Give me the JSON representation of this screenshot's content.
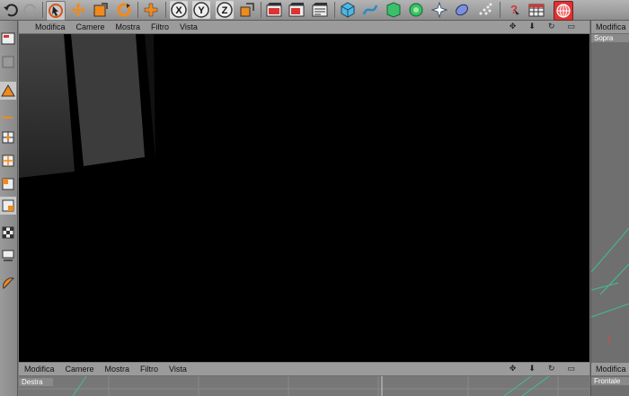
{
  "toolbar": {
    "icons": [
      "undo-icon",
      "redo-icon",
      "select-icon",
      "move-icon",
      "scale-icon",
      "rotate-icon",
      "add-icon",
      "x-axis-icon",
      "y-axis-icon",
      "z-axis-icon",
      "coordinate-system-icon",
      "render-view-icon",
      "render-picture-viewer-icon",
      "render-settings-icon",
      "cube-icon",
      "spline-icon",
      "nurbs-icon",
      "deformer-icon",
      "scene-icon",
      "light-icon",
      "particle-icon",
      "help-icon",
      "table-icon",
      "globe-icon"
    ]
  },
  "viewport_main": {
    "menu": [
      "Modifica",
      "Camere",
      "Mostra",
      "Filtro",
      "Vista"
    ]
  },
  "viewport_top": {
    "menu_label": "Modifica",
    "view_label": "Sopra"
  },
  "viewport_bottom_left": {
    "menu": [
      "Modifica",
      "Camere",
      "Mostra",
      "Filtro",
      "Vista"
    ],
    "view_label": "Destra"
  },
  "viewport_bottom_right": {
    "menu_label": "Modifica",
    "view_label": "Frontale"
  }
}
